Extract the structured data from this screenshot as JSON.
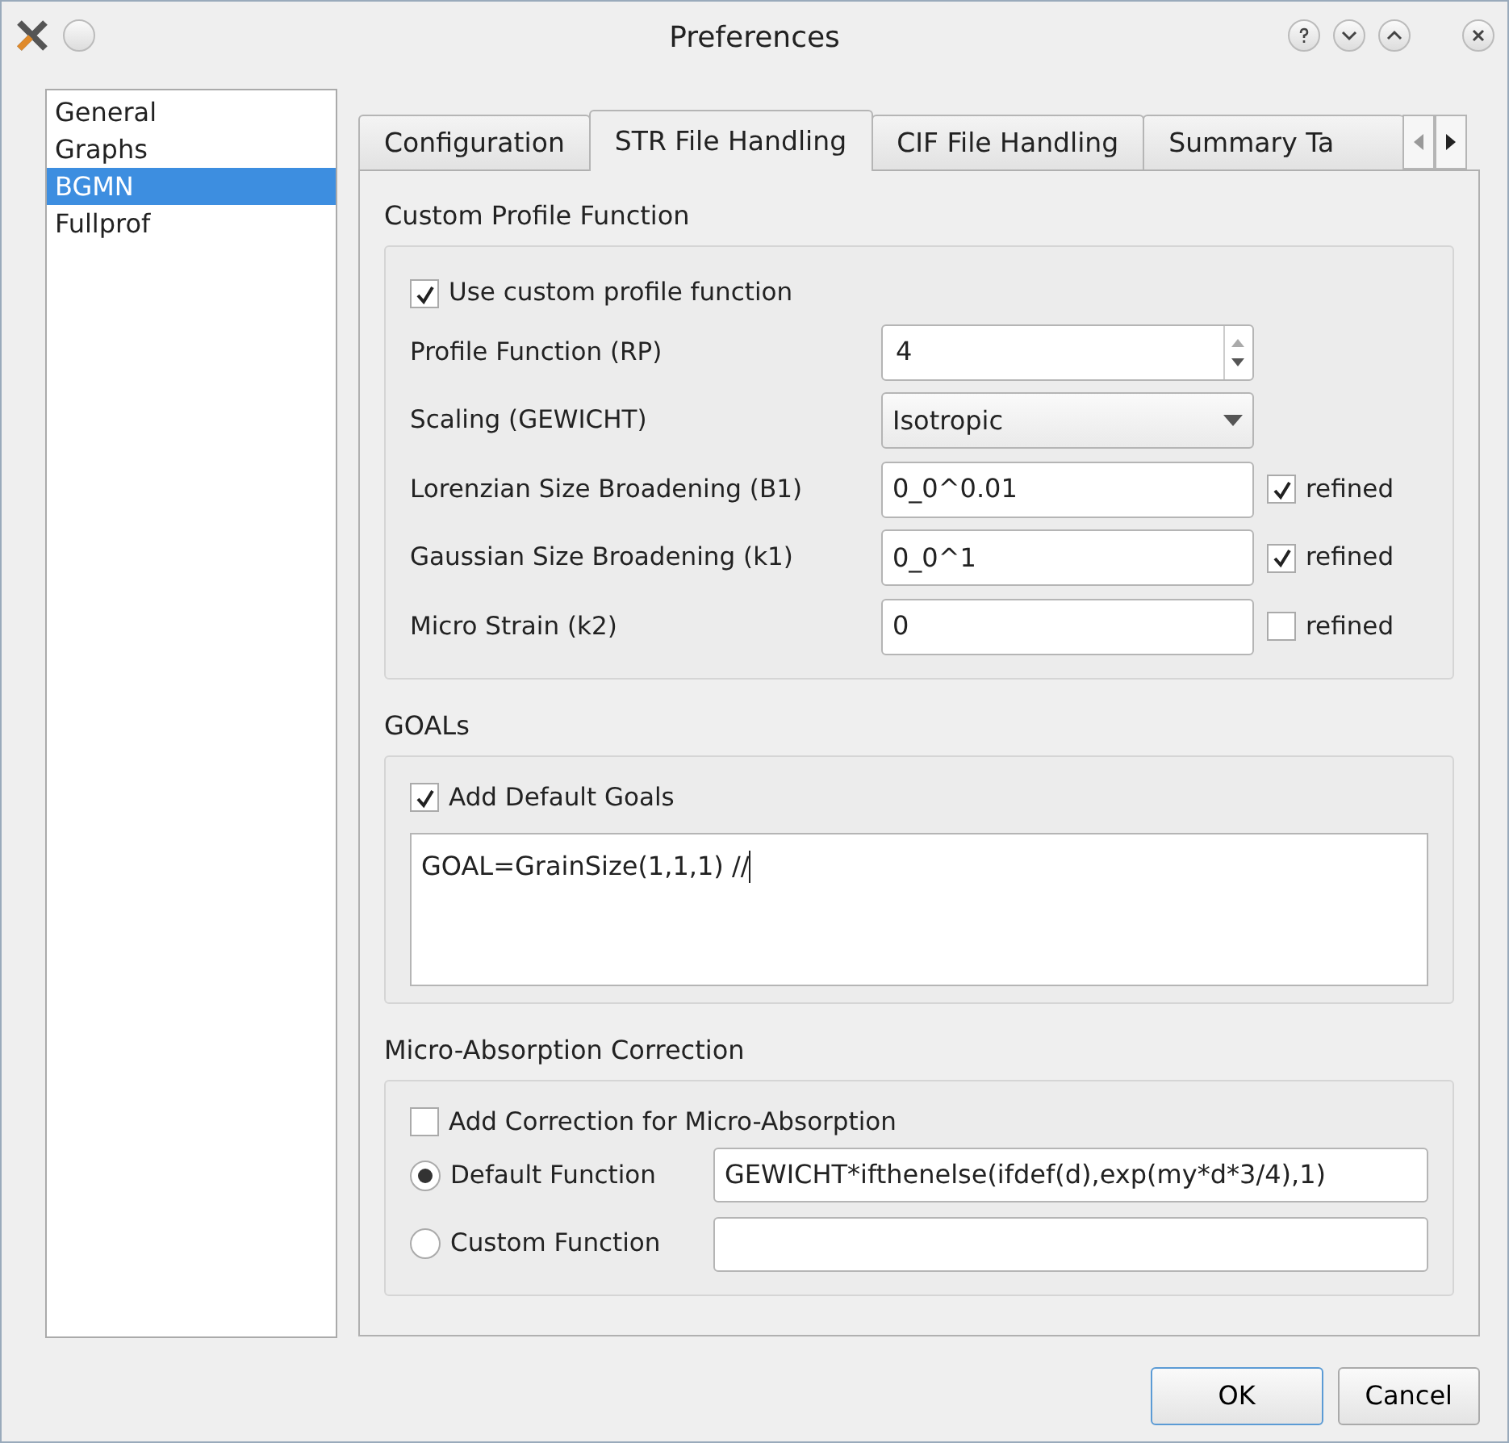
{
  "window": {
    "title": "Preferences"
  },
  "sidebar": {
    "items": [
      {
        "label": "General",
        "selected": false
      },
      {
        "label": "Graphs",
        "selected": false
      },
      {
        "label": "BGMN",
        "selected": true
      },
      {
        "label": "Fullprof",
        "selected": false
      }
    ]
  },
  "tabs": [
    {
      "label": "Configuration",
      "selected": false
    },
    {
      "label": "STR File Handling",
      "selected": true
    },
    {
      "label": "CIF File Handling",
      "selected": false
    },
    {
      "label": "Summary Ta",
      "selected": false
    }
  ],
  "custom_profile": {
    "heading": "Custom Profile Function",
    "checkbox": {
      "label": "Use custom profile function",
      "checked": true
    },
    "rows": [
      {
        "kind": "spin",
        "label": "Profile Function (RP)",
        "value": "4"
      },
      {
        "kind": "combo",
        "label": "Scaling (GEWICHT)",
        "value": "Isotropic"
      },
      {
        "kind": "text",
        "label": "Lorenzian Size Broadening (B1)",
        "value": "0_0^0.01",
        "refined": {
          "label": "refined",
          "checked": true
        }
      },
      {
        "kind": "text",
        "label": "Gaussian Size Broadening (k1)",
        "value": "0_0^1",
        "refined": {
          "label": "refined",
          "checked": true
        }
      },
      {
        "kind": "text",
        "label": "Micro Strain (k2)",
        "value": "0",
        "refined": {
          "label": "refined",
          "checked": false
        }
      }
    ]
  },
  "goals": {
    "heading": "GOALs",
    "checkbox": {
      "label": "Add Default Goals",
      "checked": true
    },
    "text": "GOAL=GrainSize(1,1,1) //"
  },
  "micro_absorption": {
    "heading": "Micro-Absorption Correction",
    "checkbox": {
      "label": "Add Correction for Micro-Absorption",
      "checked": false
    },
    "options": [
      {
        "label": "Default Function",
        "selected": true,
        "value": "GEWICHT*ifthenelse(ifdef(d),exp(my*d*3/4),1)"
      },
      {
        "label": "Custom Function",
        "selected": false
      }
    ]
  },
  "buttons": [
    "OK",
    "Cancel"
  ]
}
